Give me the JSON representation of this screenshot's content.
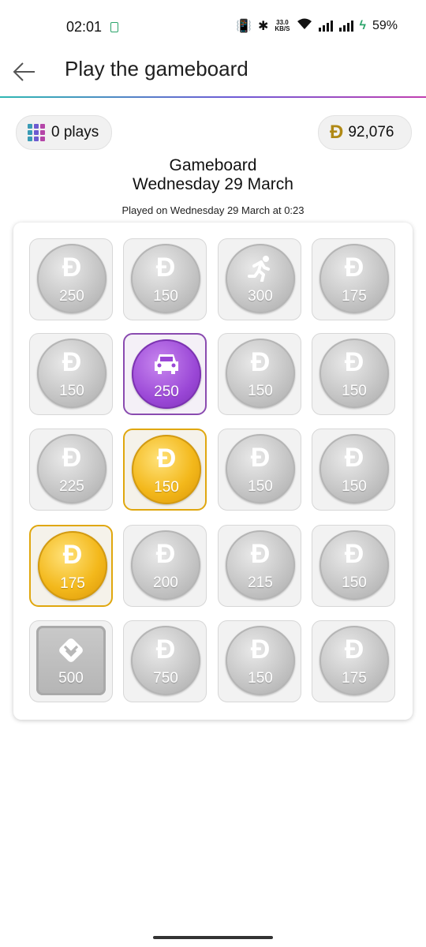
{
  "status_bar": {
    "time": "02:01",
    "speed_top": "33.0",
    "speed_bottom": "KB/S",
    "battery": "59%"
  },
  "header": {
    "title": "Play the gameboard"
  },
  "plays_chip": {
    "label": "0 plays"
  },
  "coins_chip": {
    "symbol": "Đ",
    "value": "92,076"
  },
  "gameboard": {
    "title": "Gameboard",
    "date": "Wednesday 29 March",
    "played_on": "Played on Wednesday 29 March at 0:23"
  },
  "tiles": [
    {
      "value": "250",
      "style": "silver",
      "icon": "dogecoin-d-icon"
    },
    {
      "value": "150",
      "style": "silver",
      "icon": "dogecoin-d-icon"
    },
    {
      "value": "300",
      "style": "silver",
      "icon": "running-person-icon"
    },
    {
      "value": "175",
      "style": "silver",
      "icon": "dogecoin-d-icon"
    },
    {
      "value": "150",
      "style": "silver",
      "icon": "dogecoin-d-icon"
    },
    {
      "value": "250",
      "style": "purple",
      "icon": "car-icon"
    },
    {
      "value": "150",
      "style": "silver",
      "icon": "dogecoin-d-icon"
    },
    {
      "value": "150",
      "style": "silver",
      "icon": "dogecoin-d-icon"
    },
    {
      "value": "225",
      "style": "silver",
      "icon": "dogecoin-d-icon"
    },
    {
      "value": "150",
      "style": "gold",
      "icon": "dogecoin-d-icon"
    },
    {
      "value": "150",
      "style": "silver",
      "icon": "dogecoin-d-icon"
    },
    {
      "value": "150",
      "style": "silver",
      "icon": "dogecoin-d-icon"
    },
    {
      "value": "175",
      "style": "gold",
      "icon": "dogecoin-d-icon"
    },
    {
      "value": "200",
      "style": "silver",
      "icon": "dogecoin-d-icon"
    },
    {
      "value": "215",
      "style": "silver",
      "icon": "dogecoin-d-icon"
    },
    {
      "value": "150",
      "style": "silver",
      "icon": "dogecoin-d-icon"
    },
    {
      "value": "500",
      "style": "square",
      "icon": "chevron-badge-icon"
    },
    {
      "value": "750",
      "style": "silver",
      "icon": "dogecoin-d-icon"
    },
    {
      "value": "150",
      "style": "silver",
      "icon": "dogecoin-d-icon"
    },
    {
      "value": "175",
      "style": "silver",
      "icon": "dogecoin-d-icon"
    }
  ],
  "colors": {
    "accent_gold": "#e0a70e",
    "accent_purple": "#8a4bb0",
    "coin_symbol": "#b08915"
  }
}
